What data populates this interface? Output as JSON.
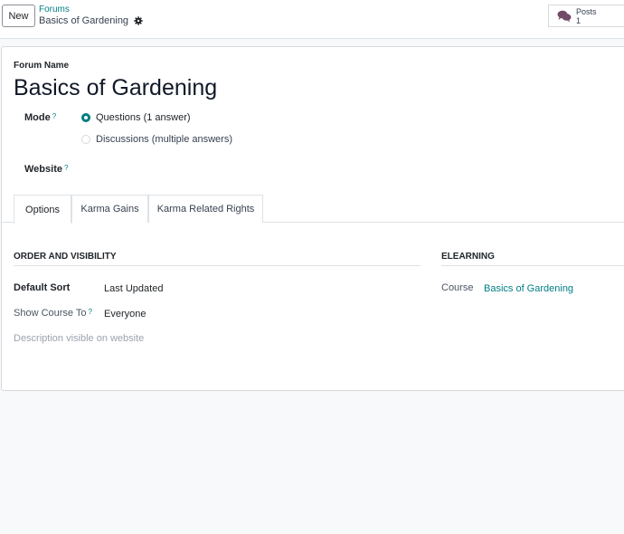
{
  "header": {
    "new_label": "New",
    "breadcrumb_parent": "Forums",
    "breadcrumb_current": "Basics of Gardening",
    "stat": {
      "label": "Posts",
      "count": "1",
      "icon": "comments-icon"
    }
  },
  "form": {
    "forum_name_label": "Forum Name",
    "forum_name": "Basics of Gardening",
    "mode_label": "Mode",
    "mode_help": "?",
    "mode_options": [
      {
        "label": "Questions (1 answer)",
        "checked": true
      },
      {
        "label": "Discussions (multiple answers)",
        "checked": false
      }
    ],
    "website_label": "Website",
    "website_help": "?"
  },
  "tabs": [
    {
      "label": "Options",
      "active": true
    },
    {
      "label": "Karma Gains",
      "active": false
    },
    {
      "label": "Karma Related Rights",
      "active": false
    }
  ],
  "options": {
    "order_title": "ORDER AND VISIBILITY",
    "default_sort_label": "Default Sort",
    "default_sort_value": "Last Updated",
    "show_course_label": "Show Course To",
    "show_course_help": "?",
    "show_course_value": "Everyone",
    "description_placeholder": "Description visible on website",
    "elearning_title": "ELEARNING",
    "course_label": "Course",
    "course_value": "Basics of Gardening"
  },
  "colors": {
    "accent": "#017e84"
  }
}
